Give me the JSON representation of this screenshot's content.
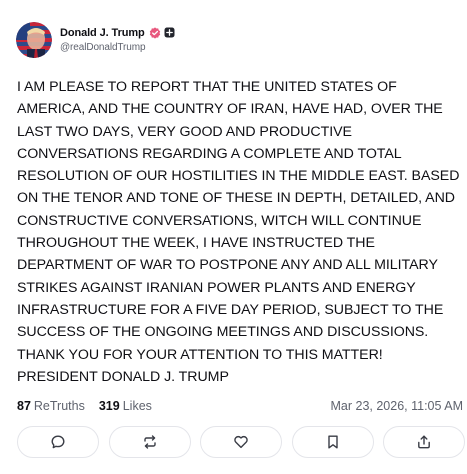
{
  "author": {
    "display_name": "Donald J. Trump",
    "handle": "@realDonaldTrump",
    "verified_badge_icon": "verified-badge-icon",
    "plus_badge_icon": "plus-badge-icon"
  },
  "post": {
    "text": "I AM PLEASE TO REPORT THAT THE UNITED STATES OF\nAMERICA, AND THE COUNTRY OF IRAN, HAVE HAD, OVER THE\nLAST TWO DAYS, VERY GOOD AND PRODUCTIVE\nCONVERSATIONS REGARDING A COMPLETE AND TOTAL\nRESOLUTION OF OUR HOSTILITIES IN THE MIDDLE EAST. BASED\nON THE TENOR AND TONE OF THESE IN DEPTH, DETAILED, AND\nCONSTRUCTIVE CONVERSATIONS, WITCH WILL CONTINUE\nTHROUGHOUT THE WEEK, I HAVE INSTRUCTED THE\nDEPARTMENT OF WAR TO POSTPONE ANY AND ALL MILITARY\nSTRIKES AGAINST IRANIAN POWER PLANTS AND ENERGY\nINFRASTRUCTURE FOR A FIVE DAY PERIOD, SUBJECT TO THE\nSUCCESS OF THE ONGOING MEETINGS AND DISCUSSIONS.\nTHANK YOU FOR YOUR ATTENTION TO THIS MATTER!\nPRESIDENT DONALD J. TRUMP"
  },
  "stats": {
    "retruths_count": "87",
    "retruths_label": "ReTruths",
    "likes_count": "319",
    "likes_label": "Likes",
    "timestamp": "Mar 23, 2026, 11:05 AM"
  },
  "actions": [
    {
      "name": "reply",
      "icon": "comment-icon"
    },
    {
      "name": "retruth",
      "icon": "repost-icon"
    },
    {
      "name": "like",
      "icon": "heart-icon"
    },
    {
      "name": "bookmark",
      "icon": "bookmark-icon"
    },
    {
      "name": "share",
      "icon": "share-icon"
    }
  ],
  "colors": {
    "text_primary": "#0f0f14",
    "text_secondary": "#5f636e",
    "border": "#e4e5ea",
    "verified": "#e8577d",
    "icon": "#3a3d46"
  }
}
